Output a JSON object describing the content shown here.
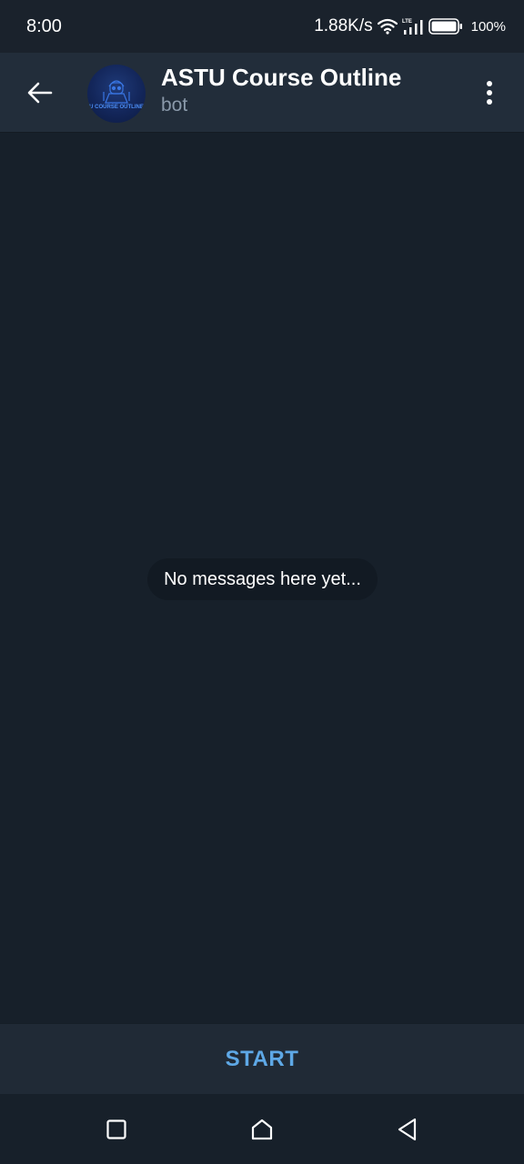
{
  "status_bar": {
    "time": "8:00",
    "net_speed": "1.88K/s",
    "network_type": "LTE",
    "battery": "100%",
    "icons": [
      "wifi-icon",
      "lte-signal-icon",
      "battery-icon"
    ]
  },
  "header": {
    "title": "ASTU Course Outline",
    "subtitle": "bot",
    "avatar_text": "U COURSE OUTLINE",
    "icons": {
      "back": "arrow-left-icon",
      "menu": "more-vertical-icon"
    }
  },
  "chat": {
    "empty_message": "No messages here yet..."
  },
  "bottom_bar": {
    "start_label": "START"
  },
  "nav_bar": {
    "icons": [
      "recent-apps-icon",
      "home-icon",
      "back-triangle-icon"
    ]
  },
  "colors": {
    "background": "#17202a",
    "header": "#222d3a",
    "accent": "#5ea8e6",
    "subtitle": "#8a99aa"
  }
}
